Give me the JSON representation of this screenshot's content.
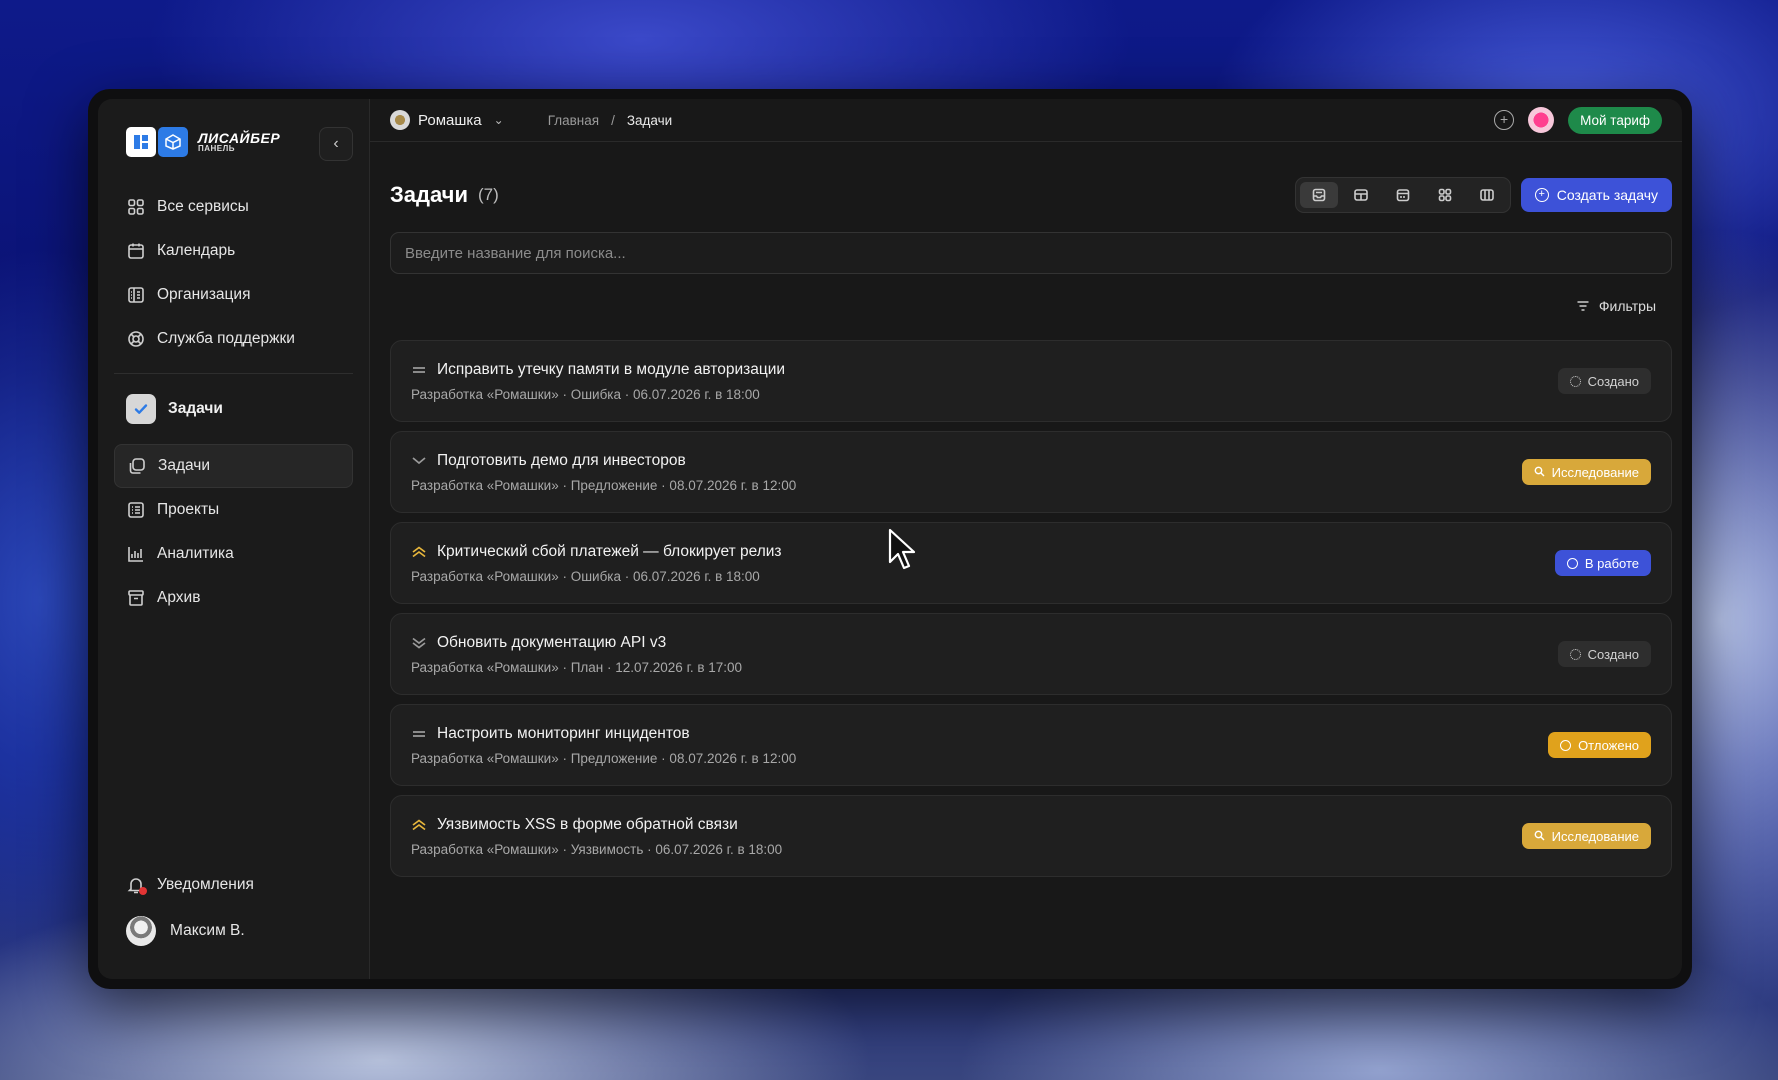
{
  "brand": {
    "title": "ЛИСАЙБЕР",
    "subtitle": "ПАНЕЛЬ"
  },
  "sidebar": {
    "top_items": [
      {
        "label": "Все сервисы",
        "icon": "grid-icon"
      },
      {
        "label": "Календарь",
        "icon": "calendar-icon"
      },
      {
        "label": "Организация",
        "icon": "building-icon"
      },
      {
        "label": "Служба поддержки",
        "icon": "lifebuoy-icon"
      }
    ],
    "section_title": "Задачи",
    "section_items": [
      {
        "label": "Задачи",
        "icon": "tasks-icon",
        "active": true
      },
      {
        "label": "Проекты",
        "icon": "list-icon"
      },
      {
        "label": "Аналитика",
        "icon": "chart-icon"
      },
      {
        "label": "Архив",
        "icon": "archive-icon"
      }
    ],
    "notifications_label": "Уведомления",
    "user_name": "Максим В."
  },
  "topbar": {
    "org_name": "Ромашка",
    "breadcrumb_home": "Главная",
    "breadcrumb_sep": "/",
    "breadcrumb_current": "Задачи",
    "tariff_label": "Мой тариф"
  },
  "main": {
    "title": "Задачи",
    "count": "(7)",
    "create_label": "Создать задачу",
    "search_placeholder": "Введите название для поиска...",
    "filters_label": "Фильтры",
    "view_modes": [
      "inbox-view-icon",
      "table-view-icon",
      "calendar-view-icon",
      "grid-view-icon",
      "columns-view-icon"
    ]
  },
  "tasks": [
    {
      "title": "Исправить утечку памяти в модуле авторизации",
      "meta": "Разработка «Ромашки» · Ошибка · 06.07.2026 г. в 18:00",
      "priority": "medium",
      "status": "Создано",
      "status_kind": "created"
    },
    {
      "title": "Подготовить демо для инвесторов",
      "meta": "Разработка «Ромашки» · Предложение · 08.07.2026 г. в 12:00",
      "priority": "low",
      "status": "Исследование",
      "status_kind": "research"
    },
    {
      "title": "Критический сбой платежей — блокирует релиз",
      "meta": "Разработка «Ромашки» · Ошибка · 06.07.2026 г. в 18:00",
      "priority": "high",
      "status": "В работе",
      "status_kind": "work"
    },
    {
      "title": "Обновить документацию API v3",
      "meta": "Разработка «Ромашки» · План · 12.07.2026 г. в 17:00",
      "priority": "lowest",
      "status": "Создано",
      "status_kind": "created"
    },
    {
      "title": "Настроить мониторинг инцидентов",
      "meta": "Разработка «Ромашки» · Предложение · 08.07.2026 г. в 12:00",
      "priority": "medium",
      "status": "Отложено",
      "status_kind": "postponed"
    },
    {
      "title": "Уязвимость XSS в форме обратной связи",
      "meta": "Разработка «Ромашки» · Уязвимость · 06.07.2026 г. в 18:00",
      "priority": "high",
      "status": "Исследование",
      "status_kind": "research"
    }
  ],
  "colors": {
    "accent": "#3d52d8",
    "tariff": "#1e8a4a",
    "research": "#d8a83a",
    "postponed": "#e0a21c",
    "priority_high": "#e8b73c"
  }
}
